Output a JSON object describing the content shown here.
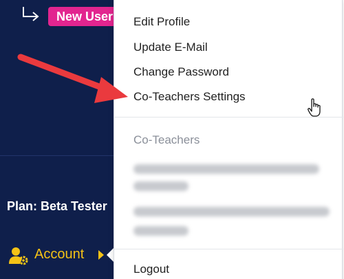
{
  "sidebar": {
    "new_user_badge": "New User",
    "plan_text": "Plan: Beta Tester",
    "account_label": "Account",
    "accent": "#f4c216",
    "background": "#0f1f4b"
  },
  "menu": {
    "items": [
      "Edit Profile",
      "Update E-Mail",
      "Change Password",
      "Co-Teachers Settings"
    ],
    "co_teachers_header": "Co-Teachers",
    "logout": "Logout"
  },
  "icons": {
    "return": "return-arrow-icon",
    "account": "user-gear-icon",
    "cursor": "hand-pointer-icon",
    "annotation": "red-arrow-annotation"
  }
}
